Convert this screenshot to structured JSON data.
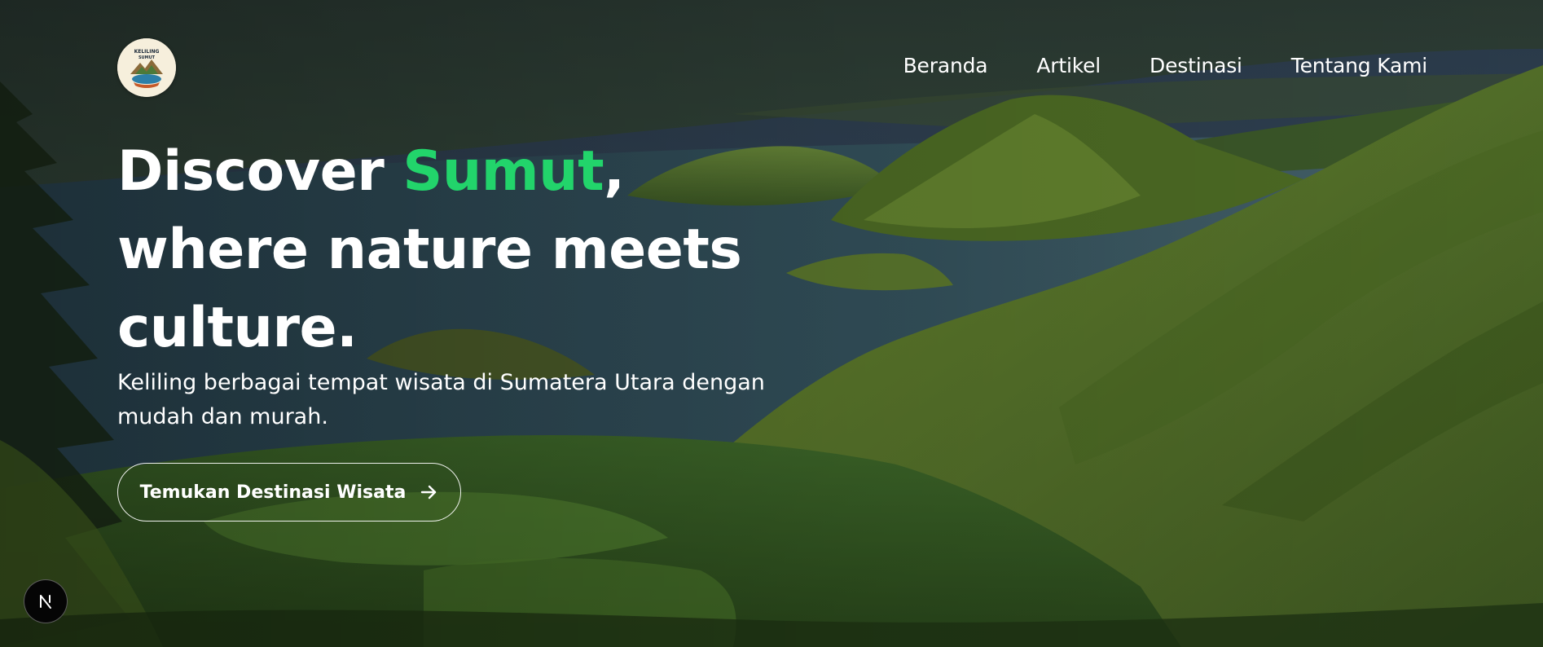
{
  "brand": {
    "logo_icon": "keliling-sumut-logo",
    "logo_text_top": "KELILING",
    "logo_text_bottom": "SUMUT"
  },
  "nav": {
    "items": [
      {
        "label": "Beranda"
      },
      {
        "label": "Artikel"
      },
      {
        "label": "Destinasi"
      },
      {
        "label": "Tentang Kami"
      }
    ]
  },
  "hero": {
    "headline_prefix": "Discover ",
    "headline_accent": "Sumut",
    "headline_comma": ",",
    "headline_line2": "where nature meets",
    "headline_line3": "culture.",
    "subtitle": "Keliling berbagai tempat wisata di Sumatera Utara dengan mudah dan murah.",
    "cta_label": "Temukan Destinasi Wisata",
    "cta_icon": "arrow-right-icon",
    "background_image": "lake-toba-landscape"
  },
  "dev_badge": {
    "icon": "nextjs-n-icon"
  },
  "colors": {
    "accent": "#22d46b",
    "text": "#ffffff"
  }
}
